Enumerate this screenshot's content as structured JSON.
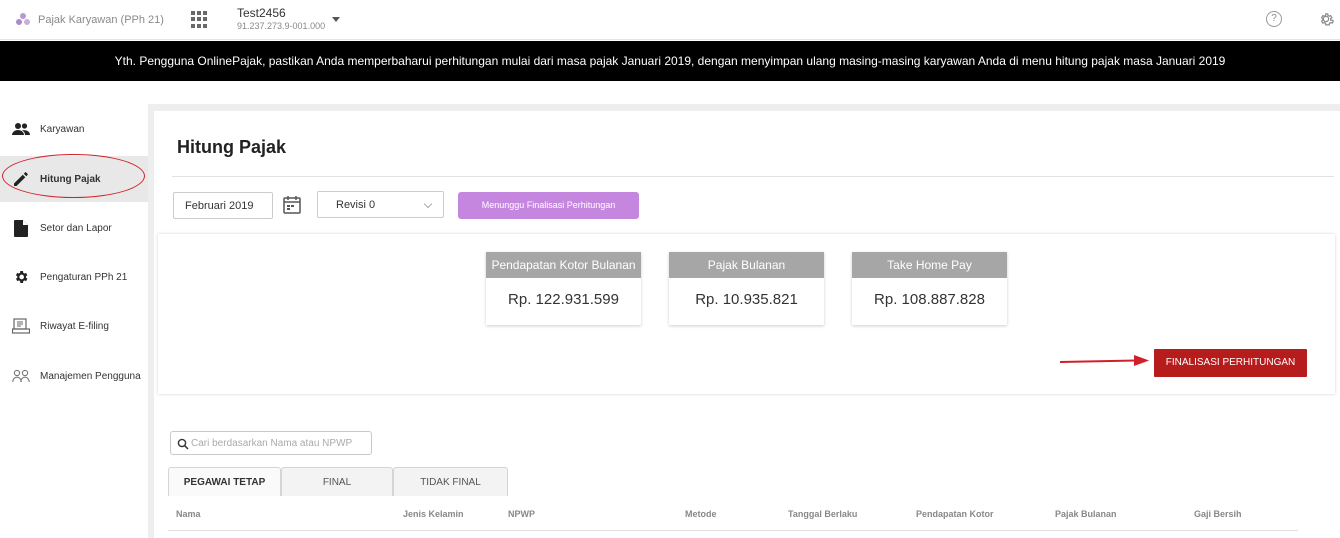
{
  "topbar": {
    "brand_name": "Pajak Karyawan (PPh 21)",
    "company_name": "Test2456",
    "company_npwp": "91.237.273.9-001.000",
    "help_glyph": "?"
  },
  "banner": {
    "text": "Yth. Pengguna OnlinePajak, pastikan Anda memperbaharui perhitungan mulai dari masa pajak Januari 2019, dengan menyimpan ulang masing-masing karyawan Anda di menu hitung pajak masa Januari 2019"
  },
  "sidebar": {
    "items": [
      {
        "label": "Karyawan",
        "icon": "people-icon",
        "active": false
      },
      {
        "label": "Hitung Pajak",
        "icon": "pencil-icon",
        "active": true
      },
      {
        "label": "Setor dan Lapor",
        "icon": "document-icon",
        "active": false
      },
      {
        "label": "Pengaturan PPh 21",
        "icon": "gear-icon",
        "active": false
      },
      {
        "label": "Riwayat E-filing",
        "icon": "history-icon",
        "active": false
      },
      {
        "label": "Manajemen Pengguna",
        "icon": "users-manage-icon",
        "active": false
      }
    ]
  },
  "page": {
    "title": "Hitung Pajak",
    "period": "Februari 2019",
    "revision": "Revisi 0",
    "status": "Menunggu Finalisasi Perhitungan"
  },
  "summary": [
    {
      "label": "Pendapatan Kotor Bulanan",
      "value": "Rp. 122.931.599"
    },
    {
      "label": "Pajak Bulanan",
      "value": "Rp. 10.935.821"
    },
    {
      "label": "Take Home Pay",
      "value": "Rp. 108.887.828"
    }
  ],
  "finalize_button": "FINALISASI PERHITUNGAN",
  "search": {
    "placeholder": "Cari berdasarkan Nama atau NPWP"
  },
  "tabs": [
    {
      "label": "PEGAWAI TETAP",
      "active": true
    },
    {
      "label": "FINAL",
      "active": false
    },
    {
      "label": "TIDAK FINAL",
      "active": false
    }
  ],
  "table": {
    "columns": [
      "Nama",
      "Jenis Kelamin",
      "NPWP",
      "Metode",
      "Tanggal Berlaku",
      "Pendapatan Kotor",
      "Pajak Bulanan",
      "Gaji Bersih"
    ]
  },
  "colors": {
    "banner_bg": "#000000",
    "status_badge": "#c586e0",
    "finalize_button": "#b71c1c",
    "annotation_red": "#d0202a"
  }
}
